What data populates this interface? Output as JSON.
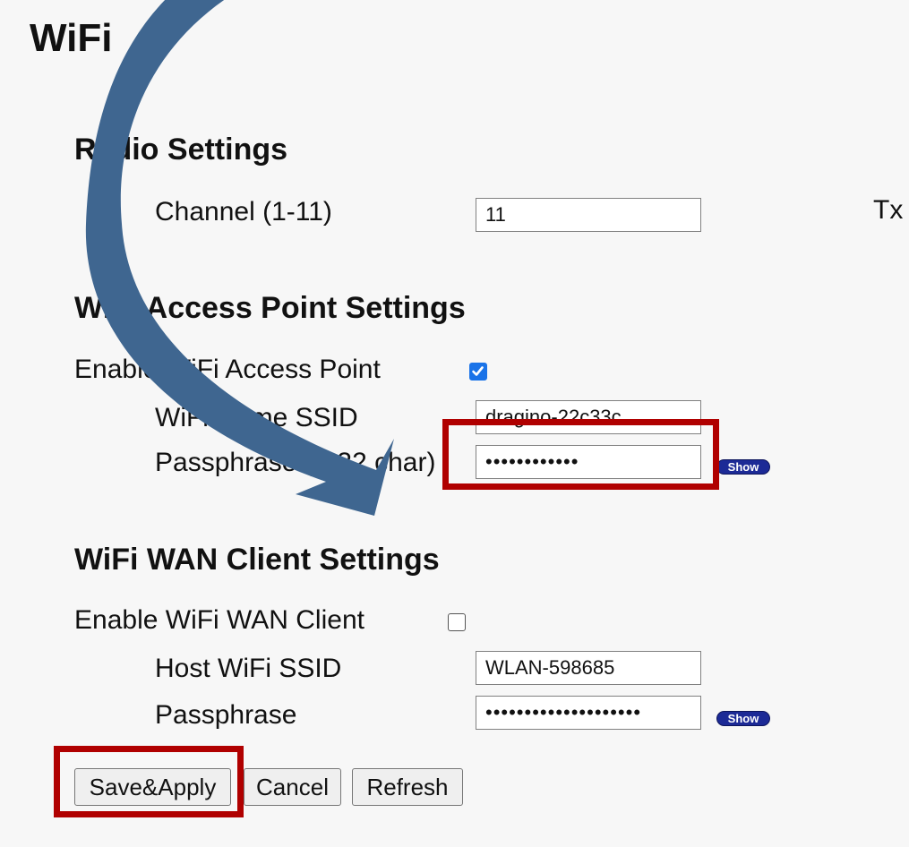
{
  "page": {
    "title": "WiFi"
  },
  "radio": {
    "heading": "Radio Settings",
    "channel_label": "Channel (1-11)",
    "channel_value": "11",
    "tx_label": "Tx"
  },
  "ap": {
    "heading": "WiFi Access Point Settings",
    "enable_label": "Enable WiFi Access Point",
    "enabled": true,
    "ssid_label": "WiFi Name SSID",
    "ssid_value": "dragino-22c33c",
    "pass_label": "Passphrase (8-32 char)",
    "pass_value": "••••••••••••",
    "show_label": "Show"
  },
  "wan": {
    "heading": "WiFi WAN Client Settings",
    "enable_label": "Enable WiFi WAN Client",
    "enabled": false,
    "host_ssid_label": "Host WiFi SSID",
    "host_ssid_value": "WLAN-598685",
    "pass_label": "Passphrase",
    "pass_value": "••••••••••••••••••••",
    "show_label": "Show"
  },
  "actions": {
    "save_label": "Save&Apply",
    "cancel_label": "Cancel",
    "refresh_label": "Refresh"
  },
  "annotations": {
    "highlight_color": "#b00000",
    "arrow_color": "#3f6690"
  }
}
